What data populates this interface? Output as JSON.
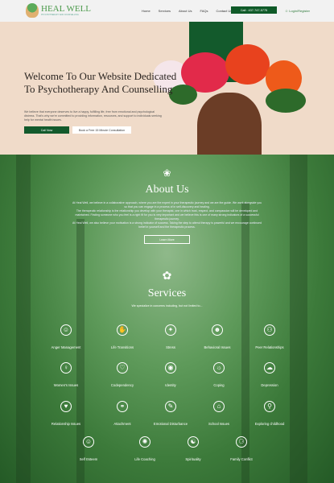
{
  "header": {
    "logo_title": "HEAL WELL",
    "logo_subtitle": "PSYCHOTHERAPY AND COUNSELLING",
    "nav": [
      "Home",
      "Services",
      "About Us",
      "FAQs",
      "Contact Us"
    ],
    "call": "Call : 437-747-5775",
    "login": "Login/Register"
  },
  "hero": {
    "title": "Welcome To Our Website Dedicated To Psychotherapy And Counselling",
    "text": "We believe that everyone deserves to live a happy, fulfilling life, free from emotional and psychological distress. That's why we're committed to providing information, resources, and support to individuals seeking help for mental health issues.",
    "btn_primary": "Call Now",
    "btn_secondary": "Book a Free 15 Minute Consultation"
  },
  "about": {
    "title": "About Us",
    "p1": "At Heal Well, we believe in a collaborative approach, where you are the expert in your therapeutic journey and we are the guide. We work alongside you so that you can engage in a process of in self-discovery and healing.",
    "p2": "The therapeutic relationship is the relationship you develop with your therapist, one in which trust, respect, and compassion will be developed and maintained. Finding someone who you feel is a right fit for you is very important and we believe this is one of many strong indicators of a successful therapeutic journey.",
    "p3": "At Heal Well, we also believe your motivation is a strong indicator of success. Taking the step to attend therapy is powerful and we encourage continued belief in yourself and the therapeutic process.",
    "button": "Learn More"
  },
  "services": {
    "title": "Services",
    "subtitle": "We specialize in concerns including, but not limited to...",
    "items": [
      "Anger Management",
      "Life Transitions",
      "Stress",
      "Behavioral Issues",
      "Peer Relationships",
      "Women's Issues",
      "Codependency",
      "Identity",
      "Coping",
      "Depression",
      "Relationship Issues",
      "Attachment",
      "Emotional Disturbance",
      "School Issues",
      "Exploring childhood",
      "Self Esteem",
      "Life Coaching",
      "Spirituality",
      "Family Conflict"
    ]
  }
}
